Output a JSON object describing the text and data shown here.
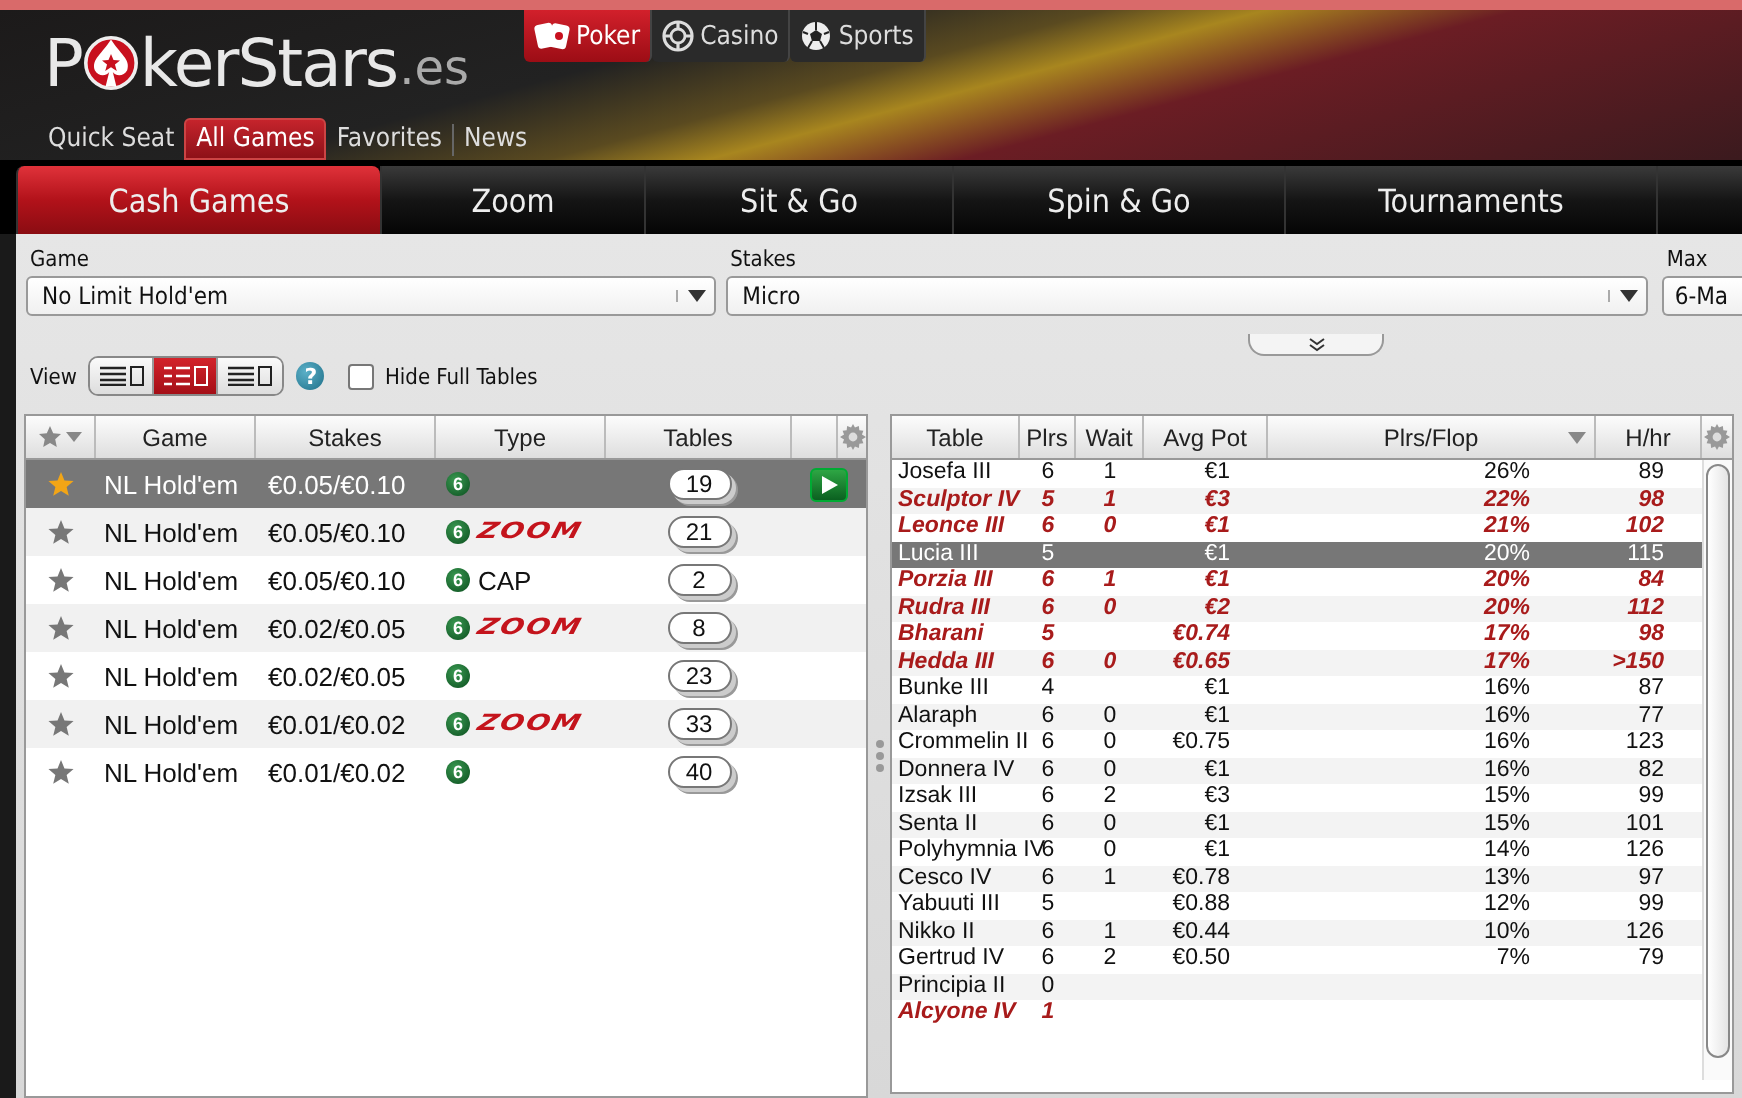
{
  "header": {
    "logo": {
      "before": "P",
      "after": "kerStars",
      "suffix": ".es"
    },
    "products": [
      {
        "kind": "poker",
        "label": "Poker",
        "selected": true
      },
      {
        "kind": "casino",
        "label": "Casino",
        "selected": false
      },
      {
        "kind": "sports",
        "label": "Sports",
        "selected": false
      }
    ],
    "nav": [
      {
        "label": "Quick Seat",
        "selected": false
      },
      {
        "label": "All Games",
        "selected": true
      },
      {
        "label": "Favorites",
        "selected": false
      },
      {
        "label": "News",
        "selected": false
      }
    ]
  },
  "tabs": [
    {
      "label": "Cash Games",
      "selected": true
    },
    {
      "label": "Zoom",
      "selected": false
    },
    {
      "label": "Sit & Go",
      "selected": false
    },
    {
      "label": "Spin & Go",
      "selected": false
    },
    {
      "label": "Tournaments",
      "selected": false
    }
  ],
  "filters": [
    {
      "label": "Game",
      "value": "No Limit Hold'em"
    },
    {
      "label": "Stakes",
      "value": "Micro"
    },
    {
      "label": "Max",
      "value": "6-Ma"
    }
  ],
  "view": {
    "label": "View",
    "modes": [
      {
        "selected": false
      },
      {
        "selected": true
      },
      {
        "selected": false
      }
    ],
    "help": "?",
    "hide_full": {
      "label": "Hide Full Tables",
      "checked": false
    }
  },
  "games": {
    "columns": [
      "Game",
      "Stakes",
      "Type",
      "Tables"
    ],
    "rows": [
      {
        "game": "NL Hold'em",
        "stakes": "€0.05/€0.10",
        "seats": "6",
        "tables": "19",
        "favorite": true,
        "selected": true
      },
      {
        "game": "NL Hold'em",
        "stakes": "€0.05/€0.10",
        "seats": "6",
        "kind": "zoom",
        "badge": "ZOOM",
        "tables": "21",
        "favorite": false,
        "selected": false
      },
      {
        "game": "NL Hold'em",
        "stakes": "€0.05/€0.10",
        "seats": "6",
        "kind": "cap",
        "badge": "CAP",
        "tables": "2",
        "favorite": false,
        "selected": false
      },
      {
        "game": "NL Hold'em",
        "stakes": "€0.02/€0.05",
        "seats": "6",
        "kind": "zoom",
        "badge": "ZOOM",
        "tables": "8",
        "favorite": false,
        "selected": false
      },
      {
        "game": "NL Hold'em",
        "stakes": "€0.02/€0.05",
        "seats": "6",
        "tables": "23",
        "favorite": false,
        "selected": false
      },
      {
        "game": "NL Hold'em",
        "stakes": "€0.01/€0.02",
        "seats": "6",
        "kind": "zoom",
        "badge": "ZOOM",
        "tables": "33",
        "favorite": false,
        "selected": false
      },
      {
        "game": "NL Hold'em",
        "stakes": "€0.01/€0.02",
        "seats": "6",
        "tables": "40",
        "favorite": false,
        "selected": false
      }
    ]
  },
  "tables": {
    "columns": [
      {
        "label": "Table",
        "sorted": false
      },
      {
        "label": "Plrs",
        "sorted": false
      },
      {
        "label": "Wait",
        "sorted": false
      },
      {
        "label": "Avg Pot",
        "sorted": false
      },
      {
        "label": "Plrs/Flop",
        "sorted": true
      },
      {
        "label": "H/hr",
        "sorted": false
      }
    ],
    "rows": [
      {
        "table": "Josefa III",
        "plrs": "6",
        "wait": "1",
        "avg_pot": "€1",
        "flop": "26%",
        "hhr": "89",
        "highlighted": false,
        "selected": false
      },
      {
        "table": "Sculptor IV",
        "plrs": "5",
        "wait": "1",
        "avg_pot": "€3",
        "flop": "22%",
        "hhr": "98",
        "highlighted": true,
        "selected": false
      },
      {
        "table": "Leonce III",
        "plrs": "6",
        "wait": "0",
        "avg_pot": "€1",
        "flop": "21%",
        "hhr": "102",
        "highlighted": true,
        "selected": false
      },
      {
        "table": "Lucia III",
        "plrs": "5",
        "avg_pot": "€1",
        "flop": "20%",
        "hhr": "115",
        "highlighted": false,
        "selected": true
      },
      {
        "table": "Porzia III",
        "plrs": "6",
        "wait": "1",
        "avg_pot": "€1",
        "flop": "20%",
        "hhr": "84",
        "highlighted": true,
        "selected": false
      },
      {
        "table": "Rudra III",
        "plrs": "6",
        "wait": "0",
        "avg_pot": "€2",
        "flop": "20%",
        "hhr": "112",
        "highlighted": true,
        "selected": false
      },
      {
        "table": "Bharani",
        "plrs": "5",
        "avg_pot": "€0.74",
        "flop": "17%",
        "hhr": "98",
        "highlighted": true,
        "selected": false
      },
      {
        "table": "Hedda III",
        "plrs": "6",
        "wait": "0",
        "avg_pot": "€0.65",
        "flop": "17%",
        "hhr": ">150",
        "highlighted": true,
        "selected": false
      },
      {
        "table": "Bunke III",
        "plrs": "4",
        "avg_pot": "€1",
        "flop": "16%",
        "hhr": "87",
        "highlighted": false,
        "selected": false
      },
      {
        "table": "Alaraph",
        "plrs": "6",
        "wait": "0",
        "avg_pot": "€1",
        "flop": "16%",
        "hhr": "77",
        "highlighted": false,
        "selected": false
      },
      {
        "table": "Crommelin II",
        "plrs": "6",
        "wait": "0",
        "avg_pot": "€0.75",
        "flop": "16%",
        "hhr": "123",
        "highlighted": false,
        "selected": false
      },
      {
        "table": "Donnera IV",
        "plrs": "6",
        "wait": "0",
        "avg_pot": "€1",
        "flop": "16%",
        "hhr": "82",
        "highlighted": false,
        "selected": false
      },
      {
        "table": "Izsak III",
        "plrs": "6",
        "wait": "2",
        "avg_pot": "€3",
        "flop": "15%",
        "hhr": "99",
        "highlighted": false,
        "selected": false
      },
      {
        "table": "Senta II",
        "plrs": "6",
        "wait": "0",
        "avg_pot": "€1",
        "flop": "15%",
        "hhr": "101",
        "highlighted": false,
        "selected": false
      },
      {
        "table": "Polyhymnia IV",
        "plrs": "6",
        "wait": "0",
        "avg_pot": "€1",
        "flop": "14%",
        "hhr": "126",
        "highlighted": false,
        "selected": false
      },
      {
        "table": "Cesco IV",
        "plrs": "6",
        "wait": "1",
        "avg_pot": "€0.78",
        "flop": "13%",
        "hhr": "97",
        "highlighted": false,
        "selected": false
      },
      {
        "table": "Yabuuti III",
        "plrs": "5",
        "avg_pot": "€0.88",
        "flop": "12%",
        "hhr": "99",
        "highlighted": false,
        "selected": false
      },
      {
        "table": "Nikko II",
        "plrs": "6",
        "wait": "1",
        "avg_pot": "€0.44",
        "flop": "10%",
        "hhr": "126",
        "highlighted": false,
        "selected": false
      },
      {
        "table": "Gertrud IV",
        "plrs": "6",
        "wait": "2",
        "avg_pot": "€0.50",
        "flop": "7%",
        "hhr": "79",
        "highlighted": false,
        "selected": false
      },
      {
        "table": "Principia II",
        "plrs": "0",
        "highlighted": false,
        "selected": false
      },
      {
        "table": "Alcyone IV",
        "plrs": "1",
        "highlighted": true,
        "selected": false
      }
    ]
  }
}
